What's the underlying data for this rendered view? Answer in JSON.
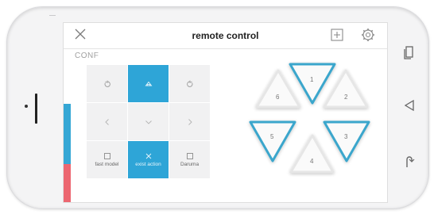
{
  "header": {
    "title": "remote control"
  },
  "section_label": "CONF",
  "grid": {
    "cells": [
      {
        "icon": "rotate-left-icon",
        "active": false,
        "label": ""
      },
      {
        "icon": "up-icon",
        "active": true,
        "label": ""
      },
      {
        "icon": "rotate-right-icon",
        "active": false,
        "label": ""
      },
      {
        "icon": "chevron-left-icon",
        "active": false,
        "label": ""
      },
      {
        "icon": "chevron-down-icon",
        "active": false,
        "label": ""
      },
      {
        "icon": "chevron-right-icon",
        "active": false,
        "label": ""
      },
      {
        "icon": "square-icon",
        "active": false,
        "label": "fast model"
      },
      {
        "icon": "x-icon",
        "active": true,
        "label": "exist action"
      },
      {
        "icon": "square-icon",
        "active": false,
        "label": "Daruma"
      }
    ]
  },
  "triangles": [
    {
      "label": "1",
      "highlighted": true
    },
    {
      "label": "2",
      "highlighted": false
    },
    {
      "label": "3",
      "highlighted": true
    },
    {
      "label": "4",
      "highlighted": false
    },
    {
      "label": "5",
      "highlighted": true
    },
    {
      "label": "6",
      "highlighted": false
    }
  ],
  "colors": {
    "accent": "#2ea5d7",
    "highlight_stroke": "#3aa6cc",
    "status_red": "#ec6670"
  }
}
